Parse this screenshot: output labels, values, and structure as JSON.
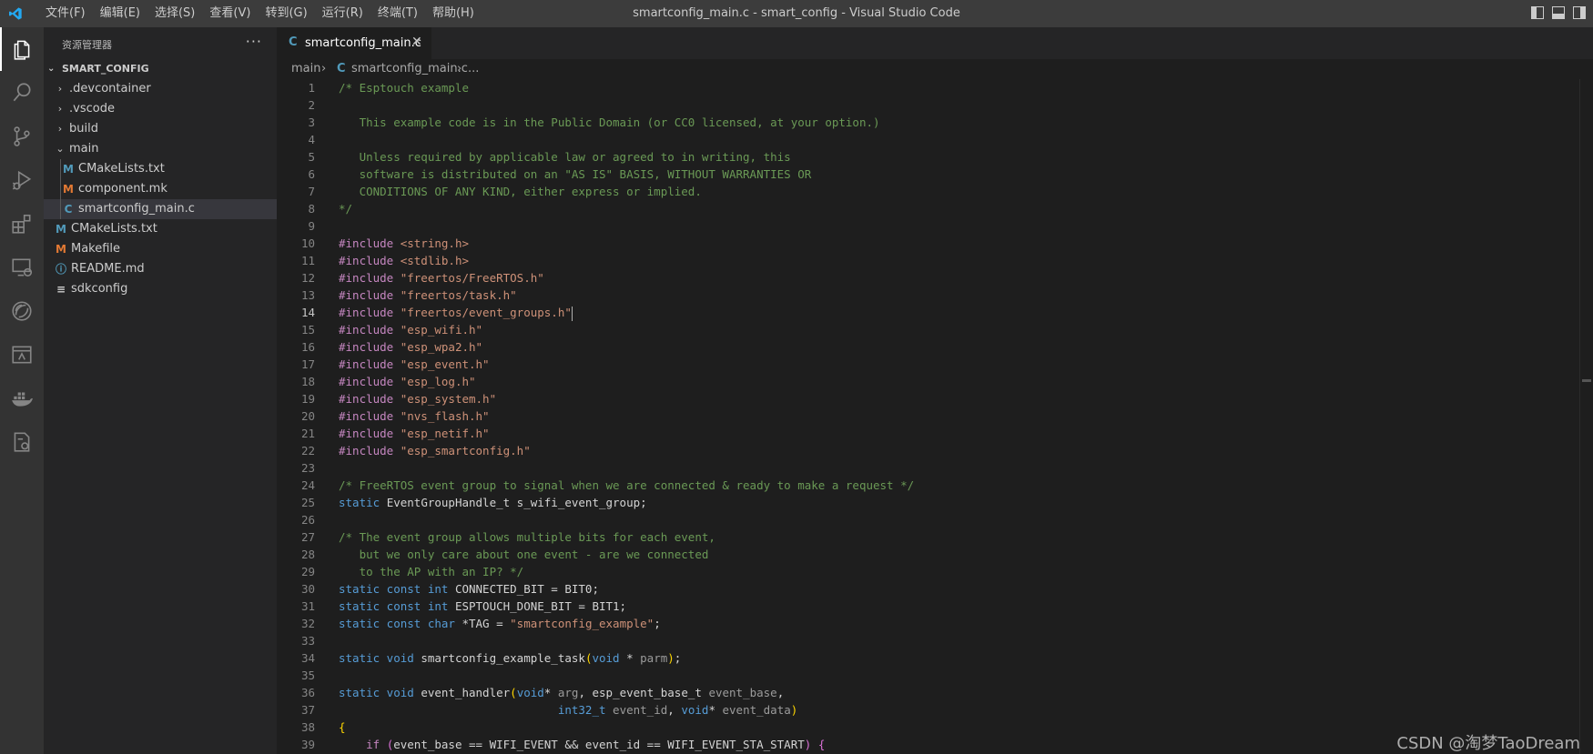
{
  "window": {
    "title": "smartconfig_main.c - smart_config - Visual Studio Code",
    "menu": [
      "文件(F)",
      "编辑(E)",
      "选择(S)",
      "查看(V)",
      "转到(G)",
      "运行(R)",
      "终端(T)",
      "帮助(H)"
    ]
  },
  "activity_bar": {
    "icons": [
      "explorer-icon",
      "search-icon",
      "source-control-icon",
      "run-debug-icon",
      "extensions-icon",
      "remote-explorer-icon",
      "esp-idf-icon",
      "terminal-panel-icon",
      "docker-icon",
      "settings-sync-icon"
    ]
  },
  "sidebar": {
    "title": "资源管理器",
    "more": "···",
    "section": "SMART_CONFIG",
    "tree": [
      {
        "name": ".devcontainer",
        "kind": "folder",
        "twisty": "›",
        "icon": ""
      },
      {
        "name": ".vscode",
        "kind": "folder",
        "twisty": "›",
        "icon": ""
      },
      {
        "name": "build",
        "kind": "folder",
        "twisty": "›",
        "icon": ""
      },
      {
        "name": "main",
        "kind": "folder-open",
        "twisty": "⌄",
        "icon": ""
      },
      {
        "name": "CMakeLists.txt",
        "kind": "cmake",
        "icon": "M"
      },
      {
        "name": "component.mk",
        "kind": "make",
        "icon": "M"
      },
      {
        "name": "smartconfig_main.c",
        "kind": "c",
        "icon": "C"
      },
      {
        "name": "CMakeLists.txt",
        "kind": "cmake",
        "icon": "M"
      },
      {
        "name": "Makefile",
        "kind": "make",
        "icon": "M"
      },
      {
        "name": "README.md",
        "kind": "info",
        "icon": "ⓘ"
      },
      {
        "name": "sdkconfig",
        "kind": "text",
        "icon": "≡"
      }
    ]
  },
  "editor": {
    "tab": {
      "label": "smartconfig_main.c",
      "icon": "C",
      "close": "✕"
    },
    "breadcrumb": {
      "folder": "main",
      "sep": "›",
      "file": "smartconfig_main.c",
      "icon": "C",
      "rest": "..."
    },
    "current_line": 14,
    "lines": [
      [
        [
          "/* Esptouch example",
          "comment"
        ]
      ],
      [],
      [
        [
          "   This example code is in the Public Domain (or CC0 licensed, at your option.)",
          "comment"
        ]
      ],
      [],
      [
        [
          "   Unless required by applicable law or agreed to in writing, this",
          "comment"
        ]
      ],
      [
        [
          "   software is distributed on an \"AS IS\" BASIS, WITHOUT WARRANTIES OR",
          "comment"
        ]
      ],
      [
        [
          "   CONDITIONS OF ANY KIND, either express or implied.",
          "comment"
        ]
      ],
      [
        [
          "*/",
          "comment"
        ]
      ],
      [],
      [
        [
          "#include ",
          "pre"
        ],
        [
          "<string.h>",
          "str"
        ]
      ],
      [
        [
          "#include ",
          "pre"
        ],
        [
          "<stdlib.h>",
          "str"
        ]
      ],
      [
        [
          "#include ",
          "pre"
        ],
        [
          "\"freertos/FreeRTOS.h\"",
          "str"
        ]
      ],
      [
        [
          "#include ",
          "pre"
        ],
        [
          "\"freertos/task.h\"",
          "str"
        ]
      ],
      [
        [
          "#include ",
          "pre"
        ],
        [
          "\"freertos/event_groups.h\"",
          "str"
        ]
      ],
      [
        [
          "#include ",
          "pre"
        ],
        [
          "\"esp_wifi.h\"",
          "str"
        ]
      ],
      [
        [
          "#include ",
          "pre"
        ],
        [
          "\"esp_wpa2.h\"",
          "str"
        ]
      ],
      [
        [
          "#include ",
          "pre"
        ],
        [
          "\"esp_event.h\"",
          "str"
        ]
      ],
      [
        [
          "#include ",
          "pre"
        ],
        [
          "\"esp_log.h\"",
          "str"
        ]
      ],
      [
        [
          "#include ",
          "pre"
        ],
        [
          "\"esp_system.h\"",
          "str"
        ]
      ],
      [
        [
          "#include ",
          "pre"
        ],
        [
          "\"nvs_flash.h\"",
          "str"
        ]
      ],
      [
        [
          "#include ",
          "pre"
        ],
        [
          "\"esp_netif.h\"",
          "str"
        ]
      ],
      [
        [
          "#include ",
          "pre"
        ],
        [
          "\"esp_smartconfig.h\"",
          "str"
        ]
      ],
      [],
      [
        [
          "/* FreeRTOS event group to signal when we are connected & ready to make a request */",
          "comment"
        ]
      ],
      [
        [
          "static ",
          "kw"
        ],
        [
          "EventGroupHandle_t s_wifi_event_group;",
          "plain"
        ]
      ],
      [],
      [
        [
          "/* The event group allows multiple bits for each event,",
          "comment"
        ]
      ],
      [
        [
          "   but we only care about one event - are we connected",
          "comment"
        ]
      ],
      [
        [
          "   to the AP with an IP? */",
          "comment"
        ]
      ],
      [
        [
          "static const int ",
          "kw"
        ],
        [
          "CONNECTED_BIT = BIT0;",
          "plain"
        ]
      ],
      [
        [
          "static const int ",
          "kw"
        ],
        [
          "ESPTOUCH_DONE_BIT = BIT1;",
          "plain"
        ]
      ],
      [
        [
          "static const char ",
          "kw"
        ],
        [
          "*TAG = ",
          "plain"
        ],
        [
          "\"smartconfig_example\"",
          "str"
        ],
        [
          ";",
          "plain"
        ]
      ],
      [],
      [
        [
          "static void ",
          "kw"
        ],
        [
          "smartconfig_example_task",
          "plain"
        ],
        [
          "(",
          "brace"
        ],
        [
          "void",
          "kw"
        ],
        [
          " * ",
          "plain"
        ],
        [
          "parm",
          "dim"
        ],
        [
          ")",
          "brace"
        ],
        [
          ";",
          "plain"
        ]
      ],
      [],
      [
        [
          "static void ",
          "kw"
        ],
        [
          "event_handler",
          "plain"
        ],
        [
          "(",
          "brace"
        ],
        [
          "void",
          "kw"
        ],
        [
          "* ",
          "plain"
        ],
        [
          "arg",
          "dim"
        ],
        [
          ", esp_event_base_t ",
          "plain"
        ],
        [
          "event_base",
          "dim"
        ],
        [
          ",",
          "plain"
        ]
      ],
      [
        [
          "                                ",
          "plain"
        ],
        [
          "int32_t ",
          "kw"
        ],
        [
          "event_id",
          "dim"
        ],
        [
          ", ",
          "plain"
        ],
        [
          "void",
          "kw"
        ],
        [
          "* ",
          "plain"
        ],
        [
          "event_data",
          "dim"
        ],
        [
          ")",
          "brace"
        ]
      ],
      [
        [
          "{",
          "brace"
        ]
      ],
      [
        [
          "    if ",
          "pre"
        ],
        [
          "(",
          "paren"
        ],
        [
          "event_base == WIFI_EVENT && event_id == WIFI_EVENT_STA_START",
          "plain"
        ],
        [
          ")",
          "paren"
        ],
        [
          " {",
          "paren"
        ]
      ]
    ]
  },
  "watermark": "CSDN @淘梦TaoDream"
}
